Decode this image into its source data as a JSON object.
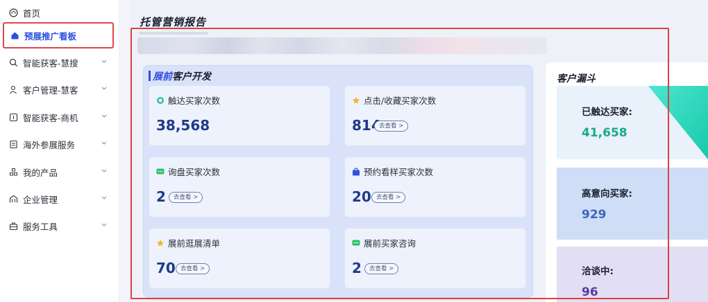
{
  "sidebar": {
    "items": [
      {
        "label": "首页",
        "icon": "home-icon",
        "expandable": false,
        "active": false
      },
      {
        "label": "预展推广看板",
        "icon": "dashboard-icon",
        "expandable": false,
        "active": true
      },
      {
        "label": "智能获客-慧搜",
        "icon": "search-icon",
        "expandable": true,
        "active": false
      },
      {
        "label": "客户管理-慧客",
        "icon": "user-icon",
        "expandable": true,
        "active": false
      },
      {
        "label": "智能获客-商机",
        "icon": "opportunity-icon",
        "expandable": true,
        "active": false
      },
      {
        "label": "海外参展服务",
        "icon": "document-icon",
        "expandable": true,
        "active": false
      },
      {
        "label": "我的产品",
        "icon": "product-icon",
        "expandable": true,
        "active": false
      },
      {
        "label": "企业管理",
        "icon": "enterprise-icon",
        "expandable": true,
        "active": false
      },
      {
        "label": "服务工具",
        "icon": "toolbox-icon",
        "expandable": true,
        "active": false
      }
    ]
  },
  "report": {
    "title": "托管营销报告"
  },
  "pre_show": {
    "title_highlight": "展前",
    "title_rest": "客户开发",
    "cards": [
      {
        "label": "触达买家次数",
        "value": "38,568",
        "icon": "reach-icon",
        "link": ""
      },
      {
        "label": "点击/收藏买家次数",
        "value": "814",
        "icon": "star-icon",
        "link": "去查看 >"
      },
      {
        "label": "询盘买家次数",
        "value": "2",
        "icon": "message-icon",
        "link": "去查看 >"
      },
      {
        "label": "预约看样买家次数",
        "value": "20",
        "icon": "bag-icon",
        "link": "去查看 >"
      },
      {
        "label": "展前逛展清单",
        "value": "70",
        "icon": "star-icon",
        "link": "去查看 >"
      },
      {
        "label": "展前买家咨询",
        "value": "2",
        "icon": "message-icon",
        "link": "去查看 >"
      }
    ]
  },
  "funnel": {
    "title": "客户漏斗",
    "steps": [
      {
        "label": "已触达买家:",
        "value": "41,658",
        "color": "#1aa88a"
      },
      {
        "label": "高意向买家:",
        "value": "929",
        "color": "#3a67b8"
      },
      {
        "label": "洽谈中:",
        "value": "96",
        "color": "#5b3aa0"
      }
    ]
  },
  "colors": {
    "accent": "#2e4fe0",
    "highlight_border": "#d9413f",
    "funnel_teal": "#2fd8c4"
  }
}
